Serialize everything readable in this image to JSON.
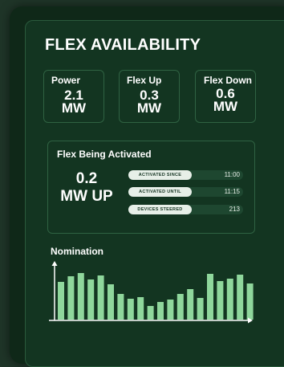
{
  "title": "FLEX AVAILABILITY",
  "stats": [
    {
      "label": "Power",
      "value_line1": "2.1",
      "value_line2": "MW"
    },
    {
      "label": "Flex Up",
      "value_line1": "0.3",
      "value_line2": "MW"
    },
    {
      "label": "Flex Down",
      "value_line1": "0.6",
      "value_line2": "MW"
    }
  ],
  "activated": {
    "label": "Flex Being Activated",
    "value_line1": "0.2",
    "value_line2": "MW UP",
    "rows": [
      {
        "label": "ACTIVATED SINCE",
        "value": "11:00"
      },
      {
        "label": "ACTIVATED UNTIL",
        "value": "11:15"
      },
      {
        "label": "DEVICES STEERED",
        "value": "213"
      }
    ]
  },
  "nomination": {
    "label": "Nomination"
  },
  "chart_data": {
    "type": "bar",
    "title": "Nomination",
    "xlabel": "",
    "ylabel": "",
    "values": [
      47,
      54,
      58,
      50,
      55,
      44,
      32,
      26,
      28,
      17,
      22,
      25,
      32,
      38,
      27,
      57,
      48,
      51,
      56,
      45
    ],
    "ylim": [
      0,
      70
    ],
    "bar_color": "#8fd79c",
    "axis_color": "#ffffff"
  },
  "colors": {
    "background": "#1f3528",
    "panel": "#133521",
    "card_border": "#2f6242",
    "pill": "#e7efe8"
  }
}
